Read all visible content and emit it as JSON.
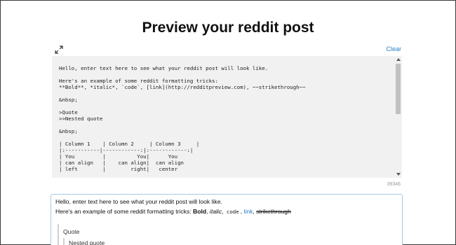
{
  "page": {
    "title": "Preview your reddit post"
  },
  "toolbar": {
    "expand_icon": "expand-icon",
    "clear_label": "Clear"
  },
  "editor": {
    "text": "Hello, enter text here to see what your reddit post will look like.\n\nHere's an example of some reddit formatting tricks:\n**Bold**, *italic*, `code`, [link](http://redditpreview.com), ~~strikethrough~~\n\n&nbsp;\n\n>Quote\n>>Nested quote\n\n&nbsp;\n\n| Column 1    | Column 2     | Column 3     |\n|:-----------|------------:|:------------:|\n| You         |          You|      You\n| can align   |    can align|  can align\n| left        |        right|   center",
    "char_count": "39346"
  },
  "preview": {
    "line1": "Hello, enter text here to see what your reddit post will look like.",
    "line2_prefix": "Here's an example of some reddit formatting tricks: ",
    "bold": "Bold",
    "sep1": ", ",
    "italic": "italic",
    "sep2": ", ",
    "code": "code",
    "sep3": ", ",
    "link": "link",
    "sep4": ", ",
    "strike": "strikethrough",
    "quote": "Quote",
    "nested_quote": "Nested quote"
  },
  "colors": {
    "link": "#2a7ec8",
    "editor_bg": "#f1f1f1",
    "preview_border": "#a9c7e3"
  }
}
